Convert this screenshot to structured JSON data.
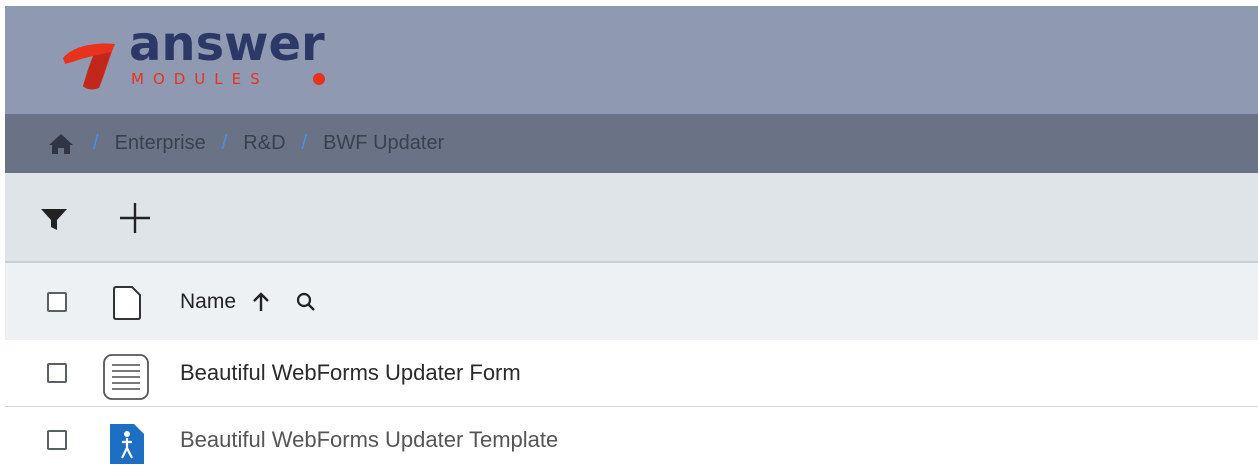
{
  "brand": {
    "name": "answer",
    "subname": "MODULES",
    "primary_color": "#2c3966",
    "accent_color": "#e8321e"
  },
  "breadcrumb": {
    "items": [
      {
        "label": "Enterprise"
      },
      {
        "label": "R&D"
      },
      {
        "label": "BWF Updater"
      }
    ],
    "separator": "/",
    "home_icon": "home-icon"
  },
  "toolbar": {
    "filter_icon": "filter-icon",
    "add_icon": "plus-icon"
  },
  "list": {
    "header": {
      "name_label": "Name",
      "sort_direction": "ascending",
      "search_icon": "search-icon",
      "type_icon": "document-icon"
    },
    "rows": [
      {
        "name": "Beautiful WebForms Updater Form",
        "icon": "form-document-icon",
        "checked": false
      },
      {
        "name": "Beautiful WebForms Updater Template",
        "icon": "template-document-icon",
        "checked": false
      }
    ]
  }
}
